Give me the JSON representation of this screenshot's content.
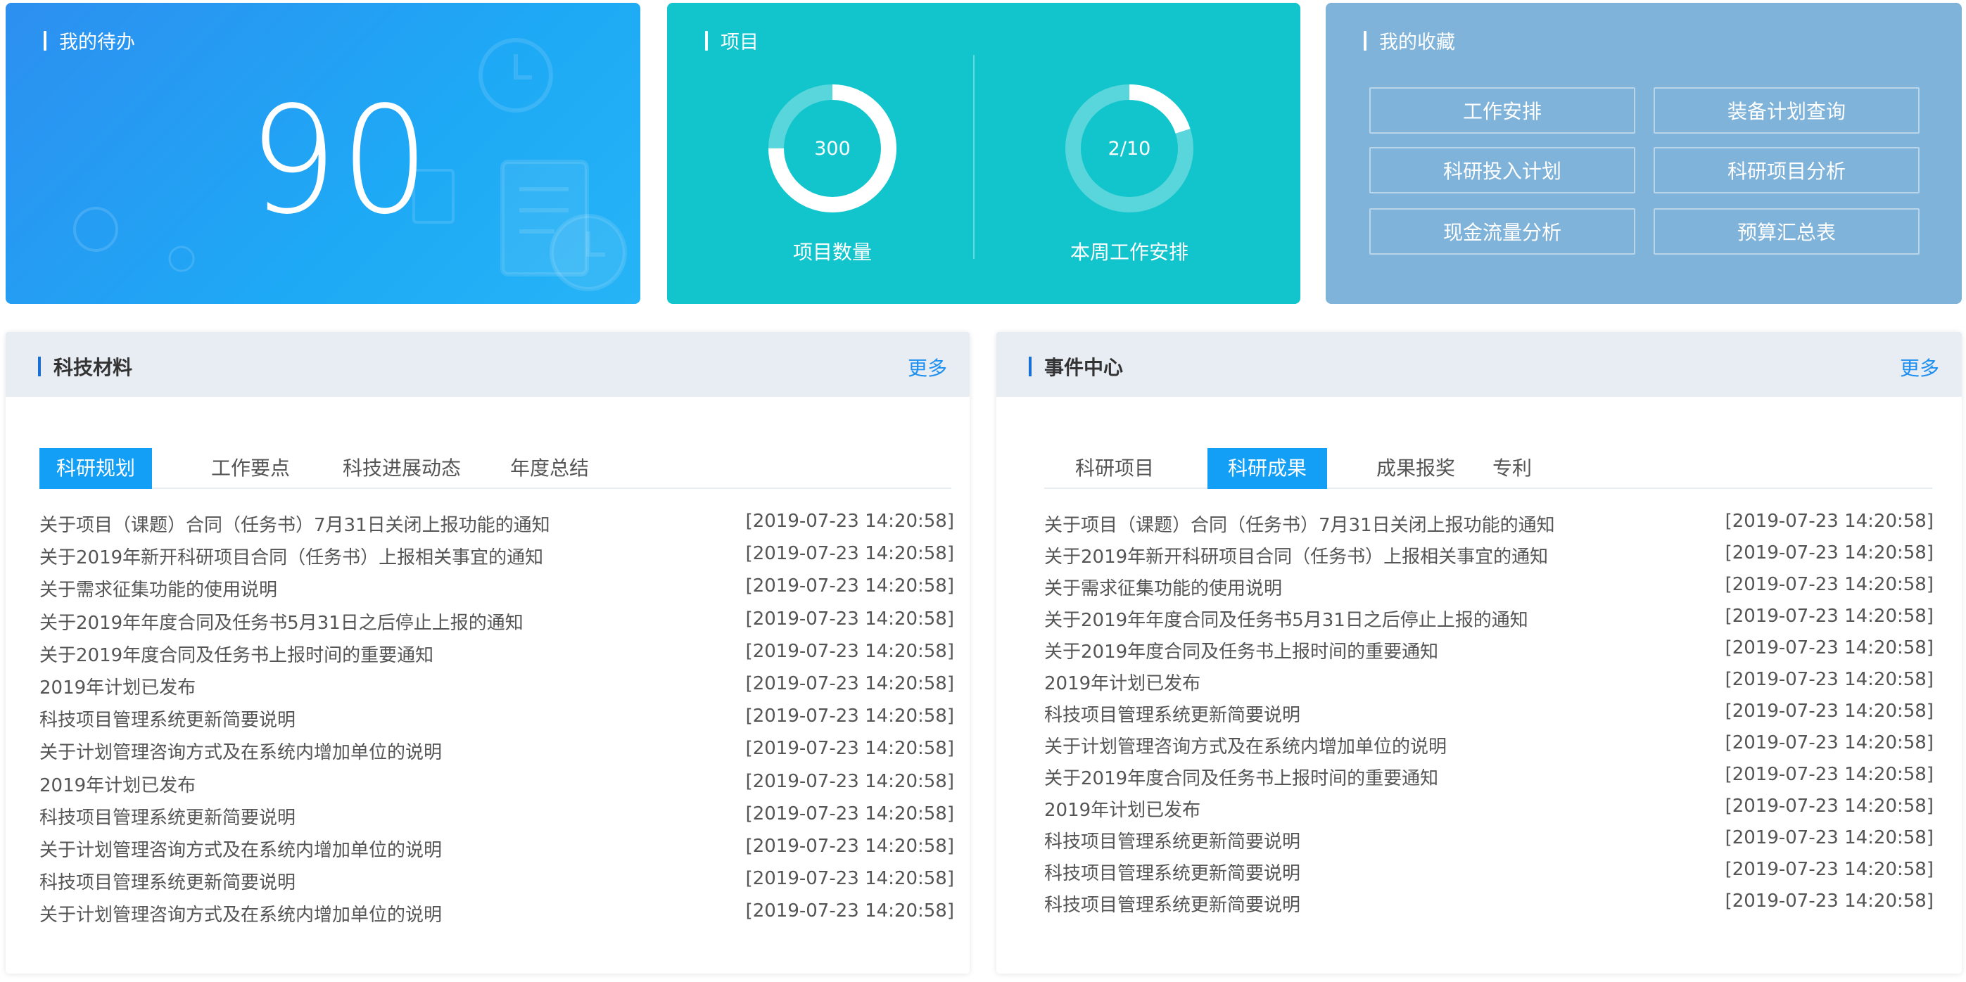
{
  "todo": {
    "title": "我的待办",
    "count": "90"
  },
  "project": {
    "title": "项目",
    "rings": [
      {
        "value": "300",
        "label": "项目数量",
        "fraction": 0.75
      },
      {
        "value": "2/10",
        "label": "本周工作安排",
        "fraction": 0.2
      }
    ]
  },
  "favorites": {
    "title": "我的收藏",
    "items": [
      "工作安排",
      "装备计划查询",
      "科研投入计划",
      "科研项目分析",
      "现金流量分析",
      "预算汇总表"
    ]
  },
  "materials": {
    "title": "科技材料",
    "more": "更多",
    "tabs": [
      "科研规划",
      "工作要点",
      "科技进展动态",
      "年度总结"
    ],
    "active_tab": 0,
    "rows": [
      {
        "title": "关于项目（课题）合同（任务书）7月31日关闭上报功能的通知",
        "date": "[2019-07-23 14:20:58]"
      },
      {
        "title": "关于2019年新开科研项目合同（任务书）上报相关事宜的通知",
        "date": "[2019-07-23 14:20:58]"
      },
      {
        "title": "关于需求征集功能的使用说明",
        "date": "[2019-07-23 14:20:58]"
      },
      {
        "title": "关于2019年年度合同及任务书5月31日之后停止上报的通知",
        "date": "[2019-07-23 14:20:58]"
      },
      {
        "title": "关于2019年度合同及任务书上报时间的重要通知",
        "date": "[2019-07-23 14:20:58]"
      },
      {
        "title": "2019年计划已发布",
        "date": "[2019-07-23 14:20:58]"
      },
      {
        "title": "科技项目管理系统更新简要说明",
        "date": "[2019-07-23 14:20:58]"
      },
      {
        "title": "关于计划管理咨询方式及在系统内增加单位的说明",
        "date": "[2019-07-23 14:20:58]"
      },
      {
        "title": "2019年计划已发布",
        "date": "[2019-07-23 14:20:58]"
      },
      {
        "title": "科技项目管理系统更新简要说明",
        "date": "[2019-07-23 14:20:58]"
      },
      {
        "title": "关于计划管理咨询方式及在系统内增加单位的说明",
        "date": "[2019-07-23 14:20:58]"
      },
      {
        "title": "科技项目管理系统更新简要说明",
        "date": "[2019-07-23 14:20:58]"
      },
      {
        "title": "关于计划管理咨询方式及在系统内增加单位的说明",
        "date": "[2019-07-23 14:20:58]"
      }
    ]
  },
  "events": {
    "title": "事件中心",
    "more": "更多",
    "tabs": [
      "科研项目",
      "科研成果",
      "成果报奖",
      "专利"
    ],
    "active_tab": 1,
    "rows": [
      {
        "title": "关于项目（课题）合同（任务书）7月31日关闭上报功能的通知",
        "date": "[2019-07-23 14:20:58]"
      },
      {
        "title": "关于2019年新开科研项目合同（任务书）上报相关事宜的通知",
        "date": "[2019-07-23 14:20:58]"
      },
      {
        "title": "关于需求征集功能的使用说明",
        "date": "[2019-07-23 14:20:58]"
      },
      {
        "title": "关于2019年年度合同及任务书5月31日之后停止上报的通知",
        "date": "[2019-07-23 14:20:58]"
      },
      {
        "title": "关于2019年度合同及任务书上报时间的重要通知",
        "date": "[2019-07-23 14:20:58]"
      },
      {
        "title": "2019年计划已发布",
        "date": "[2019-07-23 14:20:58]"
      },
      {
        "title": "科技项目管理系统更新简要说明",
        "date": "[2019-07-23 14:20:58]"
      },
      {
        "title": "关于计划管理咨询方式及在系统内增加单位的说明",
        "date": "[2019-07-23 14:20:58]"
      },
      {
        "title": "关于2019年度合同及任务书上报时间的重要通知",
        "date": "[2019-07-23 14:20:58]"
      },
      {
        "title": "2019年计划已发布",
        "date": "[2019-07-23 14:20:58]"
      },
      {
        "title": "科技项目管理系统更新简要说明",
        "date": "[2019-07-23 14:20:58]"
      },
      {
        "title": "科技项目管理系统更新简要说明",
        "date": "[2019-07-23 14:20:58]"
      },
      {
        "title": "科技项目管理系统更新简要说明",
        "date": "[2019-07-23 14:20:58]"
      }
    ]
  }
}
